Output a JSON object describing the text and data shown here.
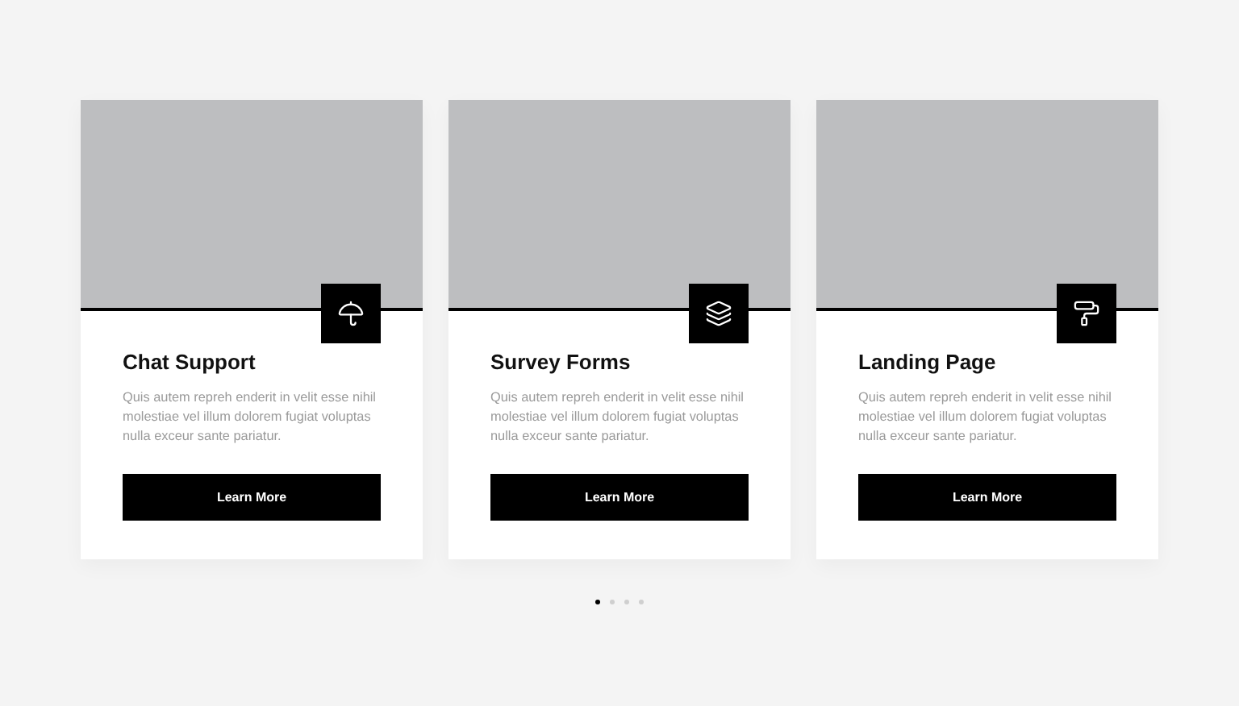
{
  "cards": [
    {
      "title": "Chat Support",
      "text": "Quis autem repreh enderit in velit esse nihil molestiae vel illum dolorem fugiat voluptas nulla exceur sante pariatur.",
      "button": "Learn More"
    },
    {
      "title": "Survey Forms",
      "text": "Quis autem repreh enderit in velit esse nihil molestiae vel illum dolorem fugiat voluptas nulla exceur sante pariatur.",
      "button": "Learn More"
    },
    {
      "title": "Landing Page",
      "text": "Quis autem repreh enderit in velit esse nihil molestiae vel illum dolorem fugiat voluptas nulla exceur sante pariatur.",
      "button": "Learn More"
    }
  ],
  "dots": [
    {
      "selected": true
    },
    {
      "selected": false
    },
    {
      "selected": false
    },
    {
      "selected": false
    }
  ]
}
